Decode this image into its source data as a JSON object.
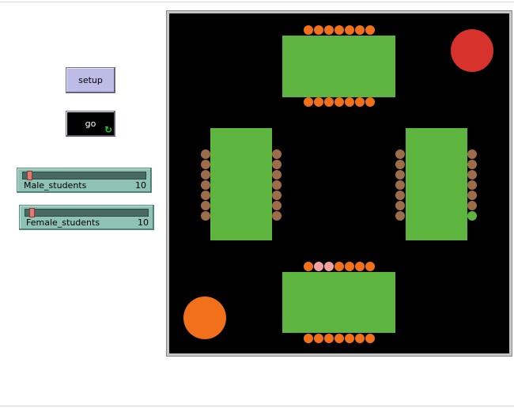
{
  "setup_button": {
    "label": "setup"
  },
  "go_button": {
    "label": "go",
    "forever_icon": "forever-arrows-icon"
  },
  "sliders": [
    {
      "name": "Male_students",
      "value": 10,
      "fraction": 0.05
    },
    {
      "name": "Female_students",
      "value": 10,
      "fraction": 0.05
    }
  ],
  "world": {
    "background_color": "#000000",
    "table_color": "#5db43f",
    "seat_orange": "#f2701a",
    "seat_brown": "#9c6d48",
    "pink_seat_color": "#f2a0a0",
    "green_seat_color": "#5db43f",
    "red_circle_color": "#d8322c",
    "orange_circle_color": "#f2701a"
  }
}
